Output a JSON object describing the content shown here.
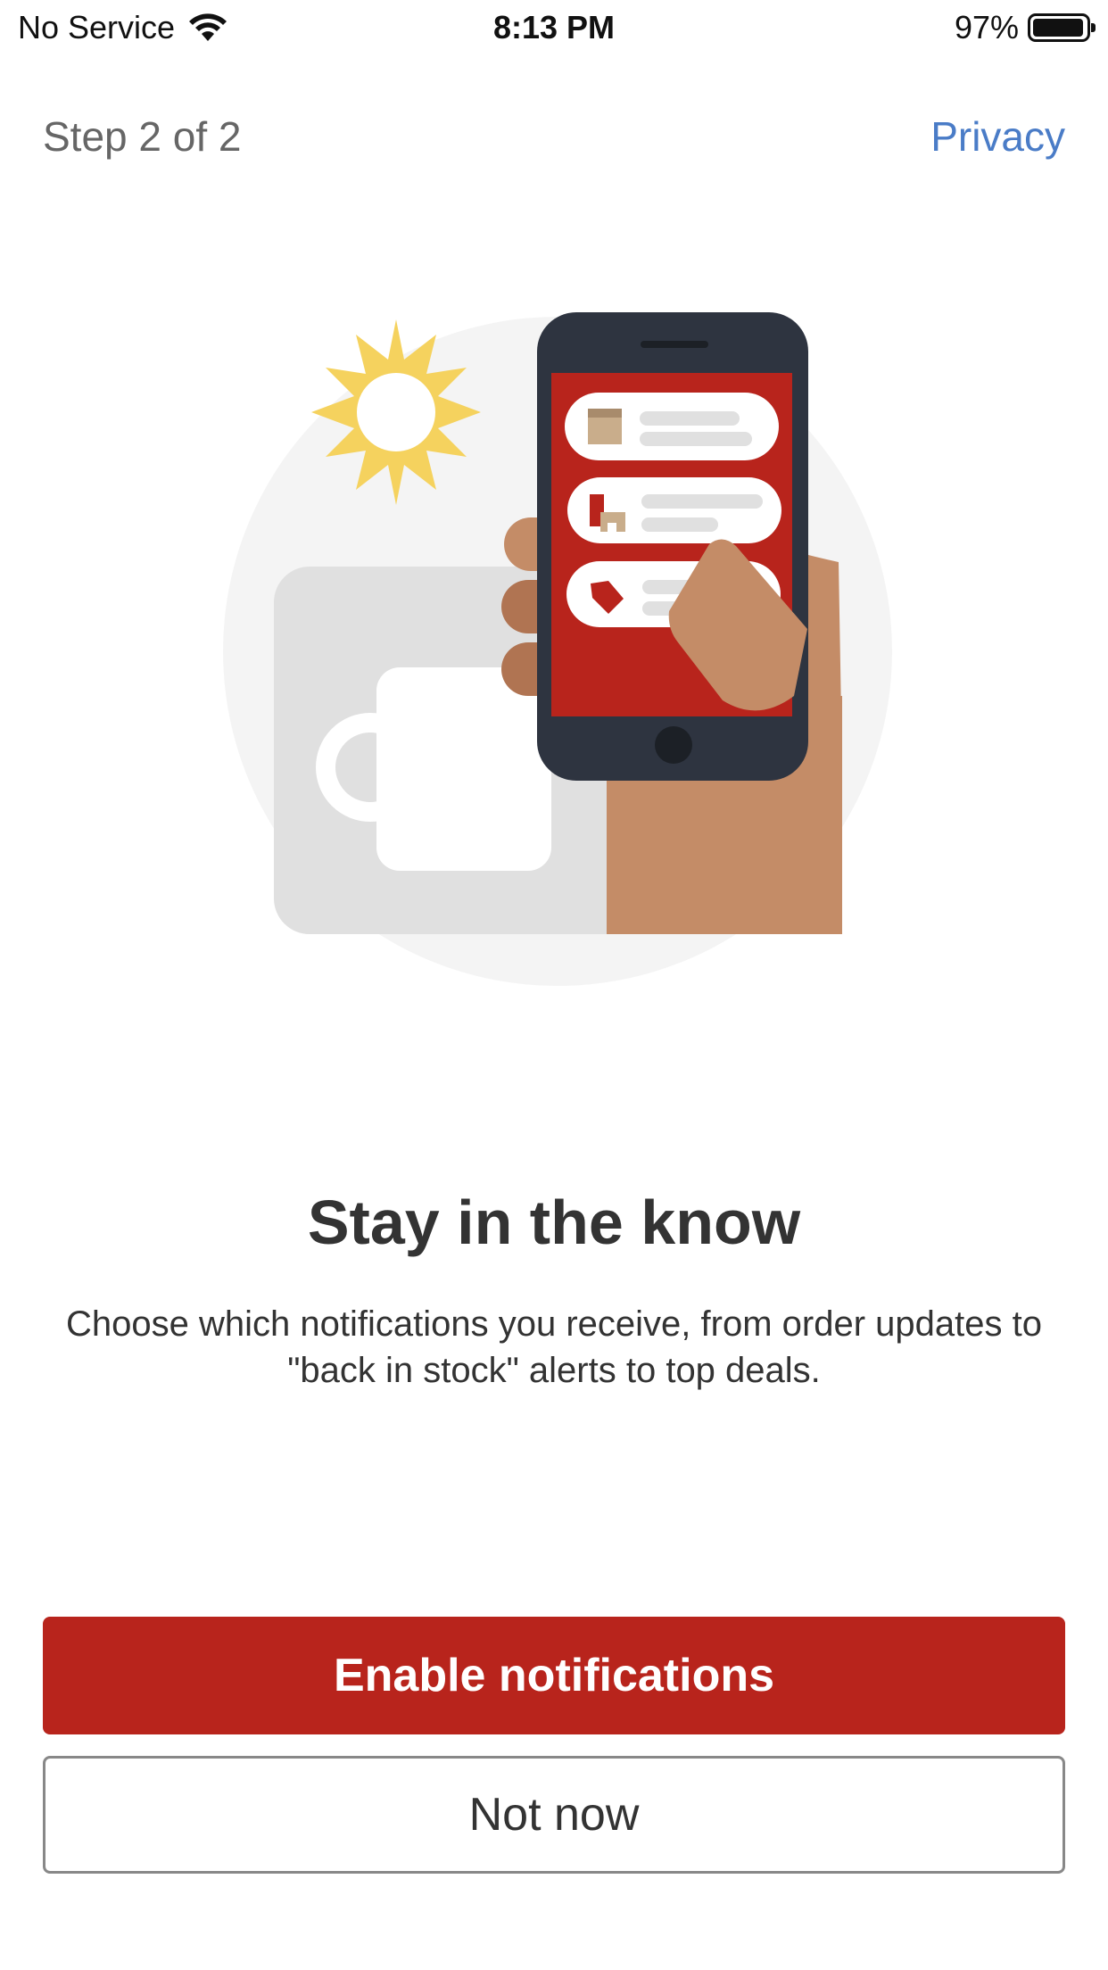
{
  "status_bar": {
    "carrier": "No Service",
    "time": "8:13 PM",
    "battery_percent": "97%",
    "battery_level": 0.97,
    "wifi_icon": "wifi-icon",
    "battery_icon": "battery-icon"
  },
  "header": {
    "step": "Step 2 of 2",
    "privacy": "Privacy"
  },
  "content": {
    "title": "Stay in the know",
    "description": "Choose which notifications you receive, from order updates to \"back in stock\" alerts to top deals."
  },
  "actions": {
    "enable_label": "Enable notifications",
    "not_now_label": "Not now"
  },
  "colors": {
    "accent": "#b8241c",
    "link": "#4a7cc7",
    "secondary_text": "#666666",
    "sun": "#f5d25e",
    "hand": "#c48c67",
    "phone": "#2e3440"
  }
}
